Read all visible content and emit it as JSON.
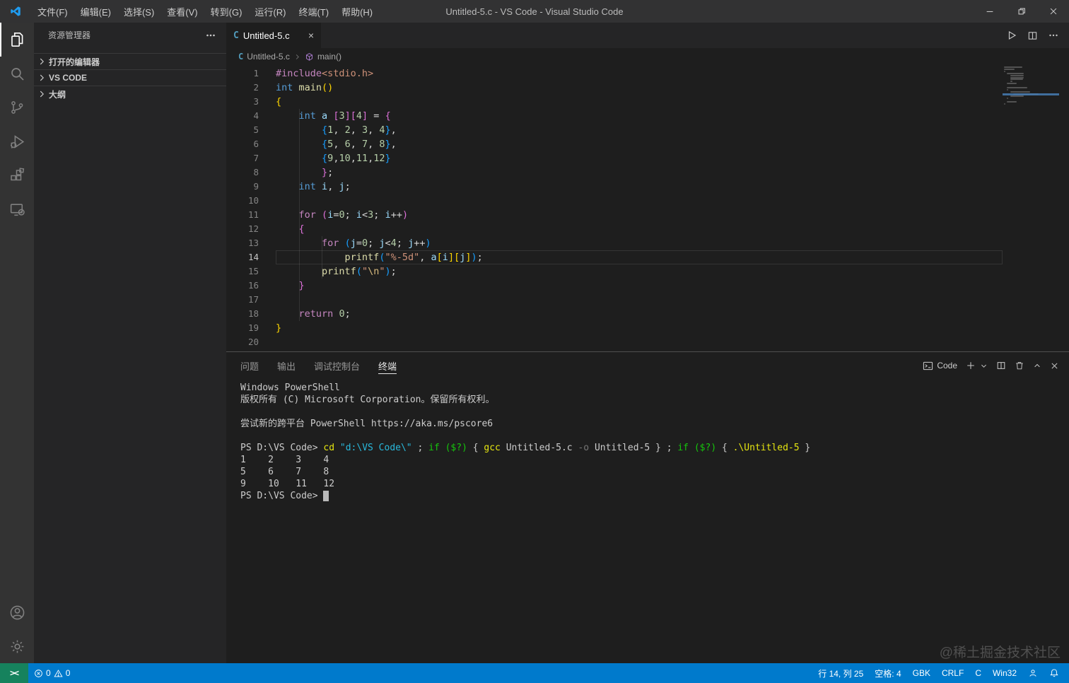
{
  "titlebar": {
    "title": "Untitled-5.c - VS Code - Visual Studio Code",
    "menus": [
      "文件(F)",
      "编辑(E)",
      "选择(S)",
      "查看(V)",
      "转到(G)",
      "运行(R)",
      "终端(T)",
      "帮助(H)"
    ]
  },
  "activity_bar": {
    "top": [
      {
        "name": "explorer",
        "active": true
      },
      {
        "name": "search",
        "active": false
      },
      {
        "name": "source-control",
        "active": false
      },
      {
        "name": "run-debug",
        "active": false
      },
      {
        "name": "extensions",
        "active": false
      },
      {
        "name": "remote-explorer",
        "active": false
      }
    ],
    "bottom": [
      {
        "name": "account",
        "active": false
      },
      {
        "name": "settings",
        "active": false
      }
    ]
  },
  "sidebar": {
    "title": "资源管理器",
    "sections": [
      {
        "label": "打开的编辑器"
      },
      {
        "label": "VS CODE"
      },
      {
        "label": "大纲"
      }
    ]
  },
  "editor": {
    "tab_label": "Untitled-5.c",
    "breadcrumb_file": "Untitled-5.c",
    "breadcrumb_symbol": "main()",
    "current_line": 14,
    "code_lines": [
      [
        [
          "#include",
          "ct"
        ],
        [
          "<stdio.h>",
          "st"
        ]
      ],
      [
        [
          "int",
          "kw"
        ],
        [
          " ",
          "pl"
        ],
        [
          "main",
          "fn"
        ],
        [
          "()",
          "b1"
        ]
      ],
      [
        [
          "{",
          "b1"
        ]
      ],
      [
        [
          "    ",
          "pl"
        ],
        [
          "int",
          "kw"
        ],
        [
          " ",
          "pl"
        ],
        [
          "a",
          "vr"
        ],
        [
          " ",
          "pl"
        ],
        [
          "[",
          "b2"
        ],
        [
          "3",
          "nm"
        ],
        [
          "]",
          "b2"
        ],
        [
          "[",
          "b2"
        ],
        [
          "4",
          "nm"
        ],
        [
          "]",
          "b2"
        ],
        [
          " = ",
          "pl"
        ],
        [
          "{",
          "b2"
        ]
      ],
      [
        [
          "        ",
          "pl"
        ],
        [
          "{",
          "b3"
        ],
        [
          "1",
          "nm"
        ],
        [
          ", ",
          "pl"
        ],
        [
          "2",
          "nm"
        ],
        [
          ", ",
          "pl"
        ],
        [
          "3",
          "nm"
        ],
        [
          ", ",
          "pl"
        ],
        [
          "4",
          "nm"
        ],
        [
          "}",
          "b3"
        ],
        [
          ",",
          "pl"
        ]
      ],
      [
        [
          "        ",
          "pl"
        ],
        [
          "{",
          "b3"
        ],
        [
          "5",
          "nm"
        ],
        [
          ", ",
          "pl"
        ],
        [
          "6",
          "nm"
        ],
        [
          ", ",
          "pl"
        ],
        [
          "7",
          "nm"
        ],
        [
          ", ",
          "pl"
        ],
        [
          "8",
          "nm"
        ],
        [
          "}",
          "b3"
        ],
        [
          ",",
          "pl"
        ]
      ],
      [
        [
          "        ",
          "pl"
        ],
        [
          "{",
          "b3"
        ],
        [
          "9",
          "nm"
        ],
        [
          ",",
          "pl"
        ],
        [
          "10",
          "nm"
        ],
        [
          ",",
          "pl"
        ],
        [
          "11",
          "nm"
        ],
        [
          ",",
          "pl"
        ],
        [
          "12",
          "nm"
        ],
        [
          "}",
          "b3"
        ]
      ],
      [
        [
          "        ",
          "pl"
        ],
        [
          "}",
          "b2"
        ],
        [
          ";",
          "pl"
        ]
      ],
      [
        [
          "    ",
          "pl"
        ],
        [
          "int",
          "kw"
        ],
        [
          " ",
          "pl"
        ],
        [
          "i",
          "vr"
        ],
        [
          ", ",
          "pl"
        ],
        [
          "j",
          "vr"
        ],
        [
          ";",
          "pl"
        ]
      ],
      [],
      [
        [
          "    ",
          "pl"
        ],
        [
          "for",
          "ct"
        ],
        [
          " ",
          "pl"
        ],
        [
          "(",
          "b2"
        ],
        [
          "i",
          "vr"
        ],
        [
          "=",
          "pl"
        ],
        [
          "0",
          "nm"
        ],
        [
          "; ",
          "pl"
        ],
        [
          "i",
          "vr"
        ],
        [
          "<",
          "pl"
        ],
        [
          "3",
          "nm"
        ],
        [
          "; ",
          "pl"
        ],
        [
          "i",
          "vr"
        ],
        [
          "++",
          "pl"
        ],
        [
          ")",
          "b2"
        ]
      ],
      [
        [
          "    ",
          "pl"
        ],
        [
          "{",
          "b2"
        ]
      ],
      [
        [
          "        ",
          "pl"
        ],
        [
          "for",
          "ct"
        ],
        [
          " ",
          "pl"
        ],
        [
          "(",
          "b3"
        ],
        [
          "j",
          "vr"
        ],
        [
          "=",
          "pl"
        ],
        [
          "0",
          "nm"
        ],
        [
          "; ",
          "pl"
        ],
        [
          "j",
          "vr"
        ],
        [
          "<",
          "pl"
        ],
        [
          "4",
          "nm"
        ],
        [
          "; ",
          "pl"
        ],
        [
          "j",
          "vr"
        ],
        [
          "++",
          "pl"
        ],
        [
          ")",
          "b3"
        ]
      ],
      [
        [
          "            ",
          "pl"
        ],
        [
          "printf",
          "fn"
        ],
        [
          "(",
          "b3"
        ],
        [
          "\"%-5d\"",
          "st"
        ],
        [
          ", ",
          "pl"
        ],
        [
          "a",
          "vr"
        ],
        [
          "[",
          "b1"
        ],
        [
          "i",
          "vr"
        ],
        [
          "]",
          "b1"
        ],
        [
          "[",
          "b1"
        ],
        [
          "j",
          "vr"
        ],
        [
          "]",
          "b1"
        ],
        [
          ")",
          "b3"
        ],
        [
          ";",
          "pl"
        ]
      ],
      [
        [
          "        ",
          "pl"
        ],
        [
          "printf",
          "fn"
        ],
        [
          "(",
          "b3"
        ],
        [
          "\"",
          "st"
        ],
        [
          "\\n",
          "es"
        ],
        [
          "\"",
          "st"
        ],
        [
          ")",
          "b3"
        ],
        [
          ";",
          "pl"
        ]
      ],
      [
        [
          "    ",
          "pl"
        ],
        [
          "}",
          "b2"
        ]
      ],
      [],
      [
        [
          "    ",
          "pl"
        ],
        [
          "return",
          "ct"
        ],
        [
          " ",
          "pl"
        ],
        [
          "0",
          "nm"
        ],
        [
          ";",
          "pl"
        ]
      ],
      [
        [
          "}",
          "b1"
        ]
      ],
      []
    ]
  },
  "panel": {
    "tabs": [
      {
        "label": "问题",
        "active": false
      },
      {
        "label": "输出",
        "active": false
      },
      {
        "label": "调试控制台",
        "active": false
      },
      {
        "label": "终端",
        "active": true
      }
    ],
    "shell_label": "Code",
    "terminal_lines": [
      [
        [
          "Windows PowerShell",
          "d"
        ]
      ],
      [
        [
          "版权所有 (C) Microsoft Corporation。保留所有权利。",
          "d"
        ]
      ],
      [],
      [
        [
          "尝试新的跨平台 PowerShell https://aka.ms/pscore6",
          "d"
        ]
      ],
      [],
      [
        [
          "PS D:\\VS Code> ",
          "d"
        ],
        [
          "cd ",
          "y"
        ],
        [
          "\"d:\\VS Code\\\"",
          "c"
        ],
        [
          " ; ",
          "d"
        ],
        [
          "if",
          "g"
        ],
        [
          " ",
          "d"
        ],
        [
          "($?)",
          "g"
        ],
        [
          " { ",
          "d"
        ],
        [
          "gcc",
          "y"
        ],
        [
          " Untitled-5.c ",
          "d"
        ],
        [
          "-o",
          "dim"
        ],
        [
          " Untitled-5 ",
          "d"
        ],
        [
          "} ; ",
          "d"
        ],
        [
          "if",
          "g"
        ],
        [
          " ",
          "d"
        ],
        [
          "($?)",
          "g"
        ],
        [
          " { ",
          "d"
        ],
        [
          ".\\Untitled-5",
          "y"
        ],
        [
          " }",
          "d"
        ]
      ],
      [
        [
          "1    2    3    4",
          "d"
        ]
      ],
      [
        [
          "5    6    7    8",
          "d"
        ]
      ],
      [
        [
          "9    10   11   12",
          "d"
        ]
      ],
      [
        [
          "PS D:\\VS Code> ",
          "d"
        ],
        [
          " ",
          "cur"
        ]
      ]
    ]
  },
  "status_bar": {
    "errors": "0",
    "warnings": "0",
    "remote_glyph": "><",
    "right_items": [
      "行 14, 列 25",
      "空格: 4",
      "GBK",
      "CRLF",
      "C",
      "Win32"
    ]
  },
  "watermark": "@稀土掘金技术社区",
  "colors": {
    "accent_blue": "#007acc",
    "remote_green": "#16825d",
    "c_file_icon": "#519aba",
    "symbol_purple": "#b180d7"
  }
}
